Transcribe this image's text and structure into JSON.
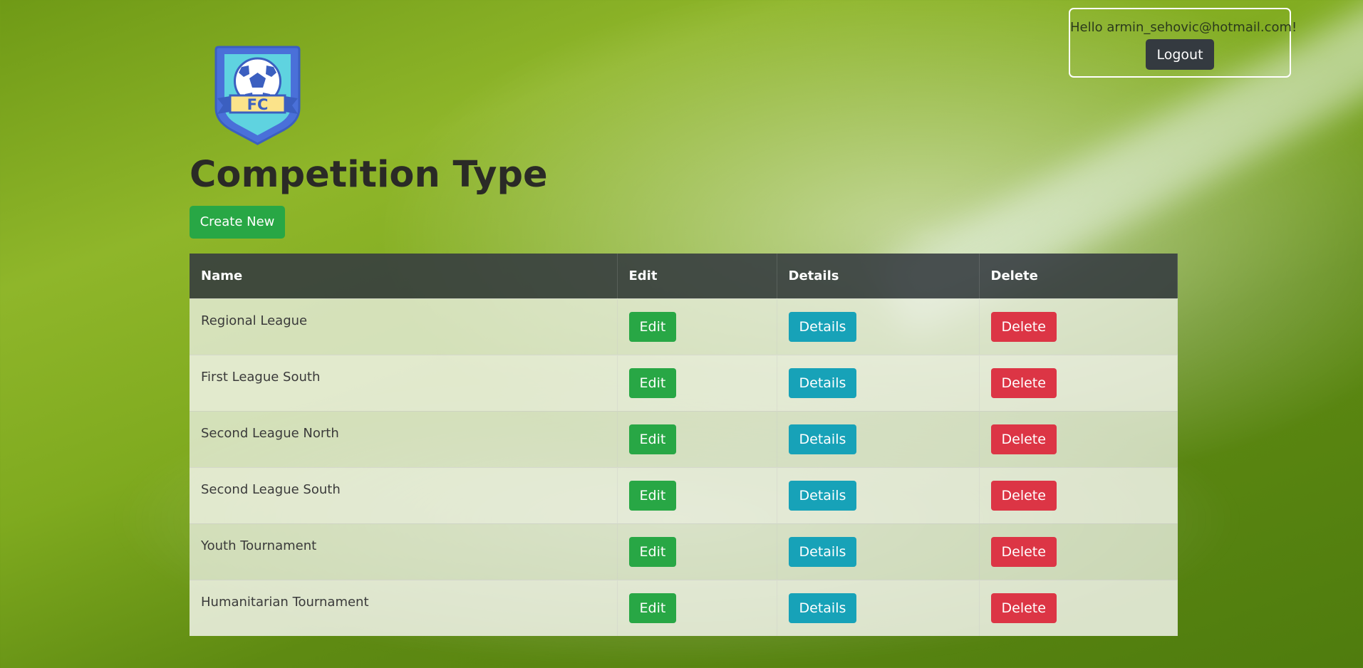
{
  "header": {
    "greeting": "Hello armin_sehovic@hotmail.com!",
    "logout_label": "Logout"
  },
  "logo": {
    "text": "FC",
    "icon": "soccer-ball-badge-icon"
  },
  "page": {
    "title": "Competition Type",
    "create_label": "Create New"
  },
  "table": {
    "headers": {
      "name": "Name",
      "edit": "Edit",
      "details": "Details",
      "delete": "Delete"
    },
    "rows": [
      {
        "name": "Regional League",
        "edit": "Edit",
        "details": "Details",
        "delete": "Delete"
      },
      {
        "name": "First League South",
        "edit": "Edit",
        "details": "Details",
        "delete": "Delete"
      },
      {
        "name": "Second League North",
        "edit": "Edit",
        "details": "Details",
        "delete": "Delete"
      },
      {
        "name": "Second League South",
        "edit": "Edit",
        "details": "Details",
        "delete": "Delete"
      },
      {
        "name": "Youth Tournament",
        "edit": "Edit",
        "details": "Details",
        "delete": "Delete"
      },
      {
        "name": "Humanitarian Tournament",
        "edit": "Edit",
        "details": "Details",
        "delete": "Delete"
      }
    ]
  },
  "colors": {
    "edit": "#28a745",
    "details": "#17a2b8",
    "delete": "#dc3545",
    "header_dark": "#343a40"
  }
}
